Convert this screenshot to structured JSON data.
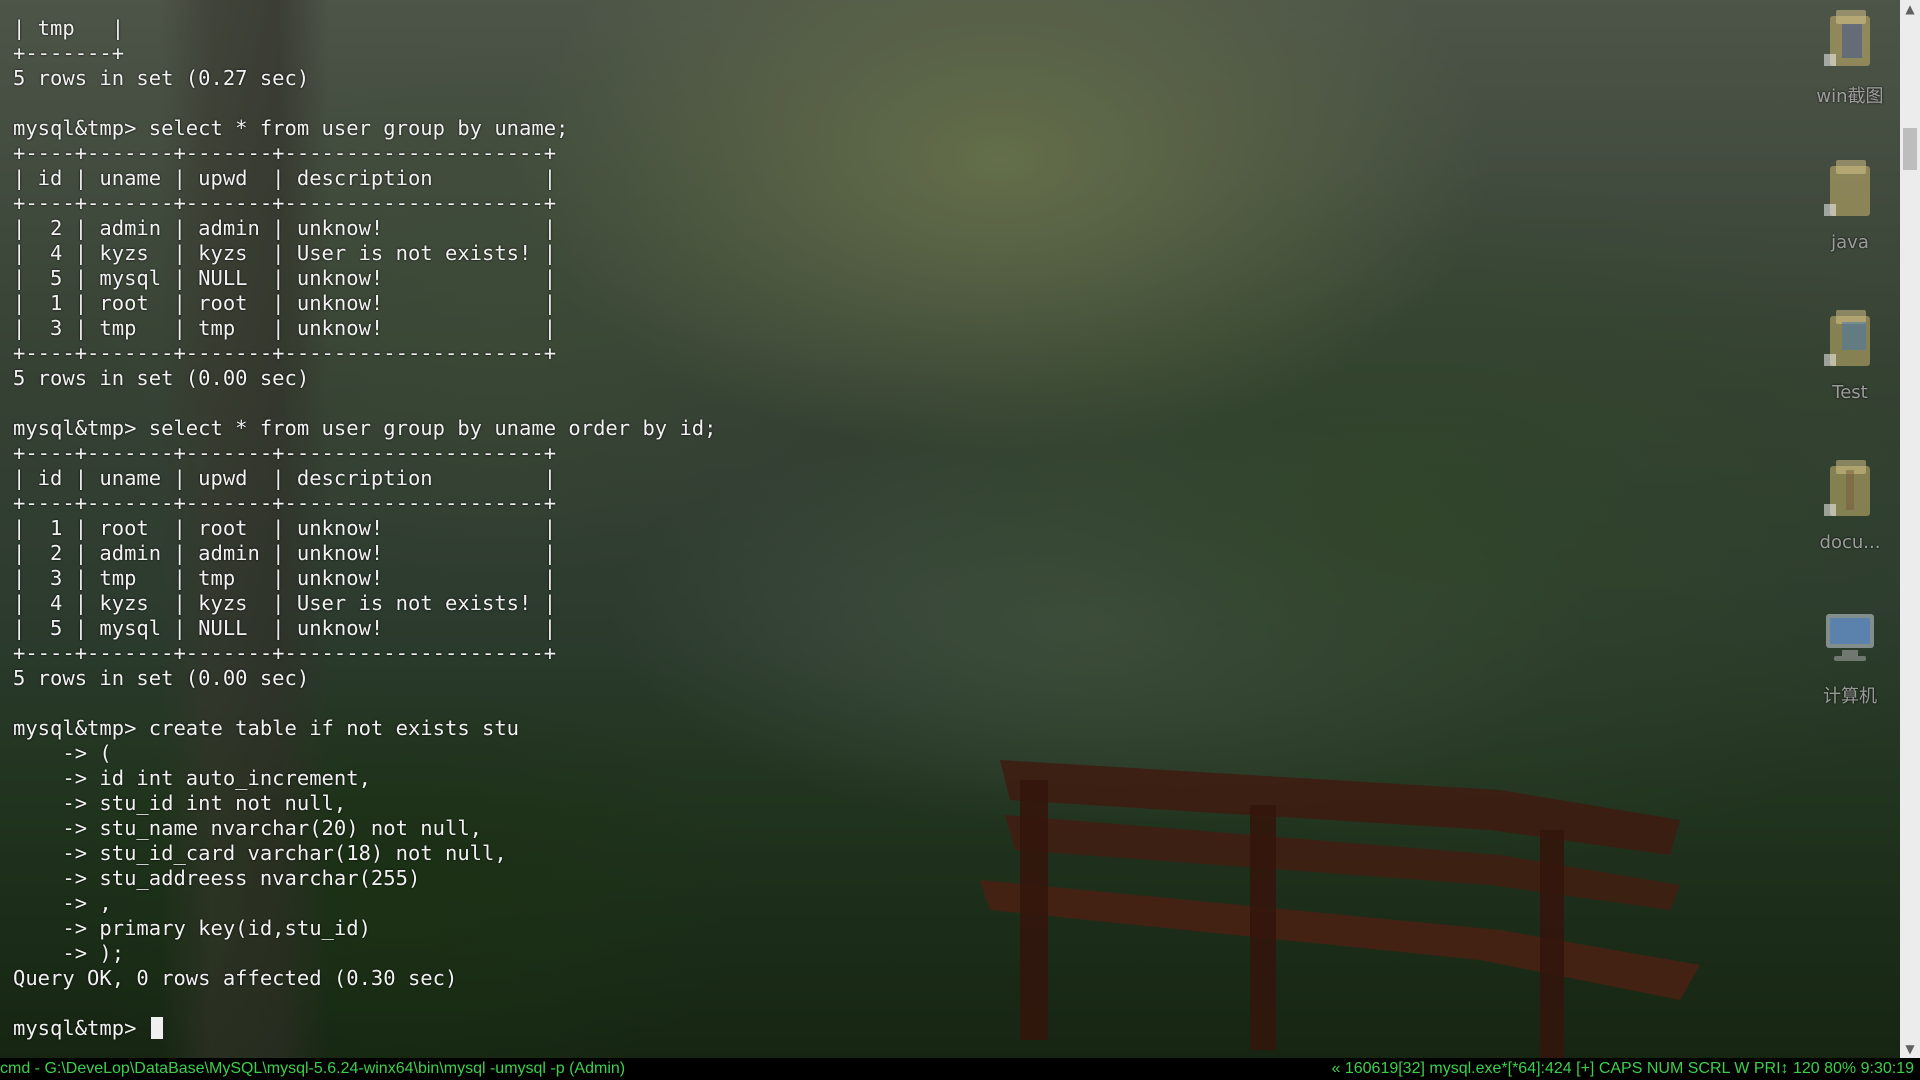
{
  "terminal": {
    "lines": [
      "| tmp   |",
      "+-------+",
      "5 rows in set (0.27 sec)",
      "",
      "mysql&tmp> select * from user group by uname;",
      "+----+-------+-------+---------------------+",
      "| id | uname | upwd  | description         |",
      "+----+-------+-------+---------------------+",
      "|  2 | admin | admin | unknow!             |",
      "|  4 | kyzs  | kyzs  | User is not exists! |",
      "|  5 | mysql | NULL  | unknow!             |",
      "|  1 | root  | root  | unknow!             |",
      "|  3 | tmp   | tmp   | unknow!             |",
      "+----+-------+-------+---------------------+",
      "5 rows in set (0.00 sec)",
      "",
      "mysql&tmp> select * from user group by uname order by id;",
      "+----+-------+-------+---------------------+",
      "| id | uname | upwd  | description         |",
      "+----+-------+-------+---------------------+",
      "|  1 | root  | root  | unknow!             |",
      "|  2 | admin | admin | unknow!             |",
      "|  3 | tmp   | tmp   | unknow!             |",
      "|  4 | kyzs  | kyzs  | User is not exists! |",
      "|  5 | mysql | NULL  | unknow!             |",
      "+----+-------+-------+---------------------+",
      "5 rows in set (0.00 sec)",
      "",
      "mysql&tmp> create table if not exists stu",
      "    -> (",
      "    -> id int auto_increment,",
      "    -> stu_id int not null,",
      "    -> stu_name nvarchar(20) not null,",
      "    -> stu_id_card varchar(18) not null,",
      "    -> stu_addreess nvarchar(255)",
      "    -> ,",
      "    -> primary key(id,stu_id)",
      "    -> );",
      "Query OK, 0 rows affected (0.30 sec)",
      ""
    ],
    "prompt": "mysql&tmp> "
  },
  "desktop_icons": [
    {
      "label": "win截图",
      "icon": "folder-shortcut-icon"
    },
    {
      "label": "java",
      "icon": "folder-shortcut-icon"
    },
    {
      "label": "Test",
      "icon": "folder-shortcut-icon"
    },
    {
      "label": "docu...",
      "icon": "folder-shortcut-icon"
    },
    {
      "label": "计算机",
      "icon": "computer-icon"
    }
  ],
  "statusbar": {
    "left": "cmd - G:\\DeveLop\\DataBase\\MySQL\\mysql-5.6.24-winx64\\bin\\mysql  -umysql -p (Admin)",
    "right": {
      "session": "« 160619[32] mysql.exe*[*64]:424 [+]",
      "caps": "CAPS",
      "num": "NUM",
      "scrl": "SCRL",
      "w": "W",
      "pri": "PRI↕",
      "size": "120",
      "zoom": "80%",
      "time": "9:30:19"
    },
    "color": "#3cd04a"
  },
  "colors": {
    "terminal_text": "#f2f2f2",
    "statusbar_bg": "#000000",
    "scrollbar_bg": "#ececec"
  }
}
